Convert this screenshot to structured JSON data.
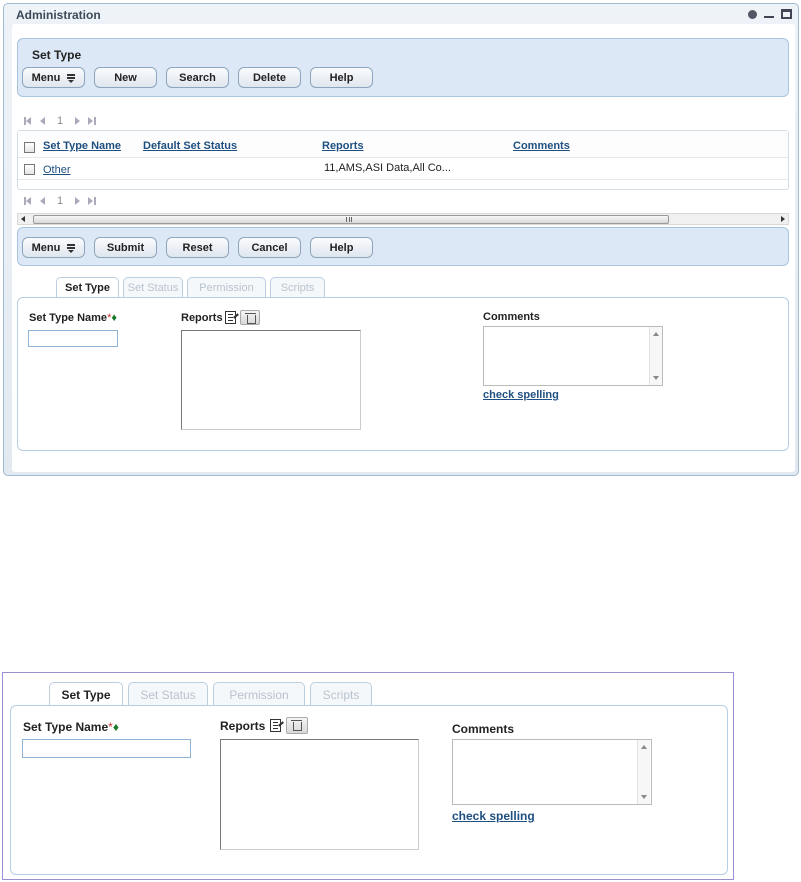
{
  "window": {
    "title": "Administration",
    "controls": [
      "refresh-icon",
      "minimize-icon",
      "maximize-icon"
    ]
  },
  "top_toolbar": {
    "title": "Set Type",
    "buttons": {
      "menu": "Menu",
      "new": "New",
      "search": "Search",
      "delete": "Delete",
      "help": "Help"
    }
  },
  "pager": {
    "page": "1"
  },
  "grid": {
    "columns": [
      "Set Type Name",
      "Default Set Status",
      "Reports",
      "Comments"
    ],
    "rows": [
      {
        "set_type_name": "Other",
        "default_set_status": "",
        "reports": "11,AMS,ASI Data,All Co...",
        "comments": ""
      }
    ]
  },
  "bottom_toolbar": {
    "buttons": {
      "menu": "Menu",
      "submit": "Submit",
      "reset": "Reset",
      "cancel": "Cancel",
      "help": "Help"
    }
  },
  "tabs": [
    "Set Type",
    "Set Status",
    "Permission",
    "Scripts"
  ],
  "active_tab": "Set Type",
  "form": {
    "set_type_name_label": "Set Type Name",
    "required_star": "*",
    "required_diamond": "♦",
    "set_type_name_value": "",
    "reports_label": "Reports",
    "comments_label": "Comments",
    "comments_value": "",
    "check_spelling": "check spelling"
  },
  "colors": {
    "link": "#1f4f80",
    "toolbar_bg": "#dce8f5",
    "required_star": "#d03030",
    "required_diamond": "#1b7a2a",
    "zoom_border": "#9a8fd0"
  }
}
